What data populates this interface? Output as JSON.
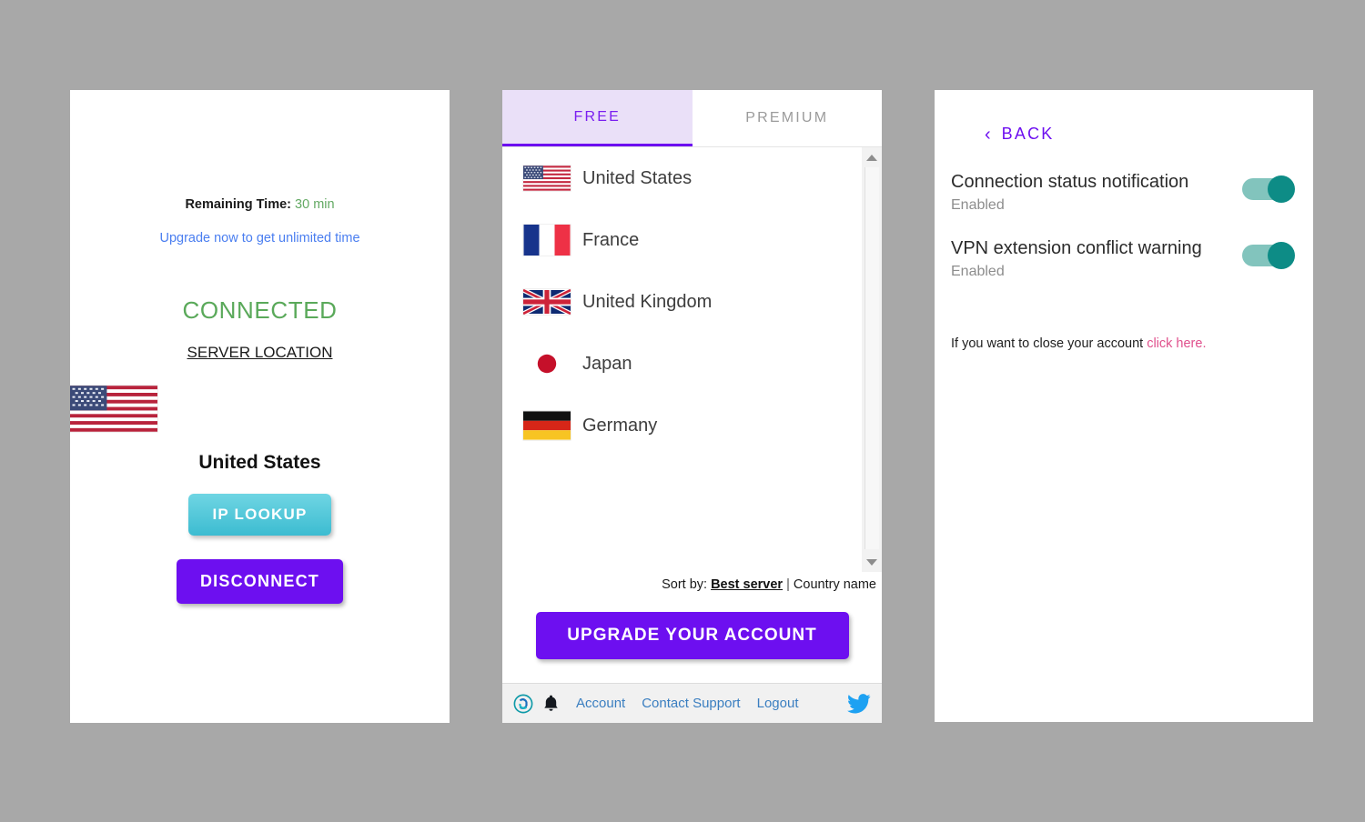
{
  "panel_status": {
    "remaining_time_label": "Remaining Time:",
    "remaining_time_value": "30 min",
    "upgrade_link": "Upgrade now to get unlimited time",
    "connection_state": "CONNECTED",
    "server_location_label": "SERVER LOCATION",
    "server_country": "United States",
    "server_flag_icon": "flag-us-icon",
    "ip_lookup_button": "IP LOOKUP",
    "disconnect_button": "DISCONNECT",
    "colors": {
      "connected": "#5aa95a",
      "time_value": "#63a963",
      "link": "#4a7ef0",
      "ip_lookup_gradient_top": "#6fd5e3",
      "ip_lookup_gradient_bottom": "#3cbcd1",
      "disconnect": "#6d0ff0"
    }
  },
  "panel_servers": {
    "tabs": [
      {
        "label": "FREE",
        "active": true
      },
      {
        "label": "PREMIUM",
        "active": false
      }
    ],
    "servers": [
      {
        "name": "United States",
        "flag": "flag-us-icon"
      },
      {
        "name": "France",
        "flag": "flag-fr-icon"
      },
      {
        "name": "United Kingdom",
        "flag": "flag-gb-icon"
      },
      {
        "name": "Japan",
        "flag": "flag-jp-icon"
      },
      {
        "name": "Germany",
        "flag": "flag-de-icon"
      }
    ],
    "sort": {
      "prefix": "Sort by:",
      "active_option": "Best server",
      "separator": "|",
      "other_option": "Country name"
    },
    "upgrade_button": "UPGRADE YOUR ACCOUNT",
    "footer": {
      "logo_icon": "vpn-logo-icon",
      "bell_icon": "bell-icon",
      "links": [
        "Account",
        "Contact Support",
        "Logout"
      ],
      "twitter_icon": "twitter-bird-icon"
    },
    "scrollbar": {
      "up_icon": "chevron-up-icon",
      "down_icon": "chevron-down-icon"
    },
    "colors": {
      "active_tab_bg": "#eae0f8",
      "active_tab_text": "#7a1ef0",
      "active_tab_underline": "#6d0ff0",
      "inactive_tab_text": "#9b9b9b",
      "footer_link": "#3a7ec0",
      "twitter": "#1da1f2",
      "upgrade": "#6d0ff0"
    }
  },
  "panel_settings": {
    "back_label": "BACK",
    "back_icon": "chevron-left-icon",
    "settings": [
      {
        "title": "Connection status notification",
        "status": "Enabled",
        "toggle_on": true
      },
      {
        "title": "VPN extension conflict warning",
        "status": "Enabled",
        "toggle_on": true
      }
    ],
    "close_account": {
      "text": "If you want to close your account",
      "link": "click here."
    },
    "colors": {
      "accent": "#6d0ff0",
      "toggle_track": "#82c4bd",
      "toggle_knob": "#0d8c86",
      "close_link": "#e0508c",
      "sub_text": "#8d8d8d"
    }
  },
  "page": {
    "background_color": "#a8a8a8"
  }
}
